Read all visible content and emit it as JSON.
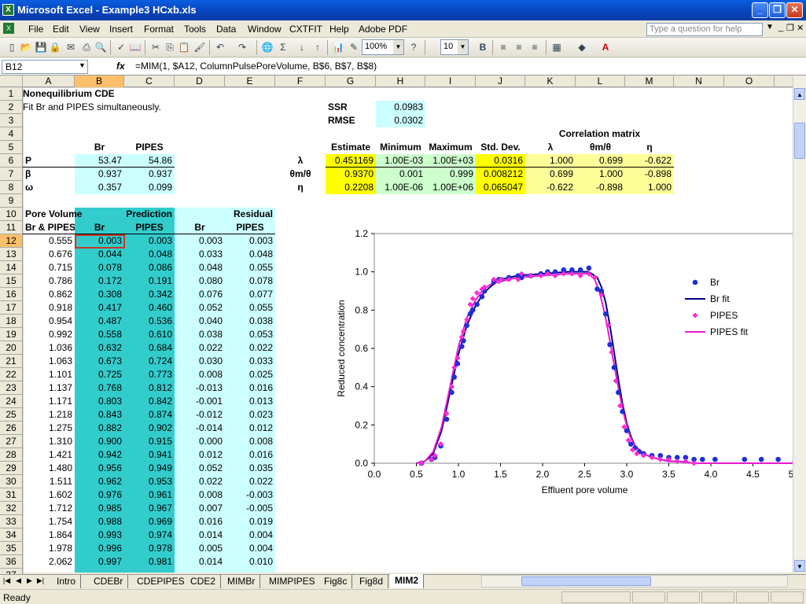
{
  "window": {
    "title": "Microsoft Excel - Example3 HCxb.xls"
  },
  "menu": [
    "File",
    "Edit",
    "View",
    "Insert",
    "Format",
    "Tools",
    "Data",
    "Window",
    "CXTFIT",
    "Help",
    "Adobe PDF"
  ],
  "help_placeholder": "Type a question for help",
  "toolbar": {
    "zoom": "100%",
    "font_size": "10"
  },
  "namebox": "B12",
  "formula": "=MIM(1, $A12, ColumnPulsePoreVolume, B$6, B$7, B$8)",
  "columns": [
    "A",
    "B",
    "C",
    "D",
    "E",
    "F",
    "G",
    "H",
    "I",
    "J",
    "K",
    "L",
    "M",
    "N",
    "O"
  ],
  "selected_column": "B",
  "rows": [
    "1",
    "2",
    "3",
    "4",
    "5",
    "6",
    "7",
    "8",
    "9",
    "10",
    "11",
    "12",
    "13",
    "14",
    "15",
    "16",
    "17",
    "18",
    "19",
    "20",
    "21",
    "22",
    "23",
    "24",
    "25",
    "26",
    "27",
    "28",
    "29",
    "30",
    "31",
    "32",
    "33",
    "34",
    "35",
    "36",
    "37"
  ],
  "selected_row": "12",
  "sheet": {
    "title": "Nonequilibrium CDE",
    "subtitle": "Fit Br and PIPES simultaneously.",
    "param_headers": [
      "Br",
      "PIPES"
    ],
    "params": [
      {
        "label": "P",
        "br": "53.47",
        "pipes": "54.86"
      },
      {
        "label": "β",
        "br": "0.937",
        "pipes": "0.937"
      },
      {
        "label": "ω",
        "br": "0.357",
        "pipes": "0.099"
      }
    ],
    "ssr_label": "SSR",
    "ssr": "0.0983",
    "rmse_label": "RMSE",
    "rmse": "0.0302",
    "corr_title": "Correlation matrix",
    "stats_headers": [
      "Estimate",
      "Minimum",
      "Maximum",
      "Std. Dev.",
      "λ",
      "θm/θ",
      "η"
    ],
    "stats_rows": [
      {
        "label": "λ",
        "cells": [
          "0.451169",
          "1.00E-03",
          "1.00E+03",
          "0.0316",
          "1.000",
          "0.699",
          "-0.622"
        ]
      },
      {
        "label": "θm/θ",
        "cells": [
          "0.9370",
          "0.001",
          "0.999",
          "0.008212",
          "0.699",
          "1.000",
          "-0.898"
        ]
      },
      {
        "label": "η",
        "cells": [
          "0.2208",
          "1.00E-06",
          "1.00E+06",
          "0.065047",
          "-0.622",
          "-0.898",
          "1.000"
        ]
      }
    ],
    "table_head1": [
      "Pore Volume",
      "Prediction",
      "Residual"
    ],
    "table_head2": [
      "Br & PIPES",
      "Br",
      "PIPES",
      "Br",
      "PIPES"
    ],
    "table": [
      [
        "0.555",
        "0.003",
        "0.003",
        "0.003",
        "0.003"
      ],
      [
        "0.676",
        "0.044",
        "0.048",
        "0.033",
        "0.048"
      ],
      [
        "0.715",
        "0.078",
        "0.086",
        "0.048",
        "0.055"
      ],
      [
        "0.786",
        "0.172",
        "0.191",
        "0.080",
        "0.078"
      ],
      [
        "0.862",
        "0.308",
        "0.342",
        "0.076",
        "0.077"
      ],
      [
        "0.918",
        "0.417",
        "0.460",
        "0.052",
        "0.055"
      ],
      [
        "0.954",
        "0.487",
        "0.536",
        "0.040",
        "0.038"
      ],
      [
        "0.992",
        "0.558",
        "0.610",
        "0.038",
        "0.053"
      ],
      [
        "1.036",
        "0.632",
        "0.684",
        "0.022",
        "0.022"
      ],
      [
        "1.063",
        "0.673",
        "0.724",
        "0.030",
        "0.033"
      ],
      [
        "1.101",
        "0.725",
        "0.773",
        "0.008",
        "0.025"
      ],
      [
        "1.137",
        "0.768",
        "0.812",
        "-0.013",
        "0.016"
      ],
      [
        "1.171",
        "0.803",
        "0.842",
        "-0.001",
        "0.013"
      ],
      [
        "1.218",
        "0.843",
        "0.874",
        "-0.012",
        "0.023"
      ],
      [
        "1.275",
        "0.882",
        "0.902",
        "-0.014",
        "0.012"
      ],
      [
        "1.310",
        "0.900",
        "0.915",
        "0.000",
        "0.008"
      ],
      [
        "1.421",
        "0.942",
        "0.941",
        "0.012",
        "0.016"
      ],
      [
        "1.480",
        "0.956",
        "0.949",
        "0.052",
        "0.035"
      ],
      [
        "1.511",
        "0.962",
        "0.953",
        "0.022",
        "0.022"
      ],
      [
        "1.602",
        "0.976",
        "0.961",
        "0.008",
        "-0.003"
      ],
      [
        "1.712",
        "0.985",
        "0.967",
        "0.007",
        "-0.005"
      ],
      [
        "1.754",
        "0.988",
        "0.969",
        "0.016",
        "0.019"
      ],
      [
        "1.864",
        "0.993",
        "0.974",
        "0.014",
        "0.004"
      ],
      [
        "1.978",
        "0.996",
        "0.978",
        "0.005",
        "0.004"
      ],
      [
        "2.062",
        "0.997",
        "0.981",
        "0.014",
        "0.010"
      ]
    ]
  },
  "chart_data": {
    "type": "scatter",
    "xlabel": "Effluent pore volume",
    "ylabel": "Reduced concentration",
    "xlim": [
      0,
      5
    ],
    "ylim": [
      0,
      1.2
    ],
    "xticks": [
      "0.0",
      "0.5",
      "1.0",
      "1.5",
      "2.0",
      "2.5",
      "3.0",
      "3.5",
      "4.0",
      "4.5",
      "5.0"
    ],
    "yticks": [
      "0.0",
      "0.2",
      "0.4",
      "0.6",
      "0.8",
      "1.0",
      "1.2"
    ],
    "legend_position": "right",
    "colors": {
      "br": "#1f2fd8",
      "br_fit": "#00008b",
      "pipes": "#ff2bd6",
      "pipes_fit": "#e81ad0"
    },
    "series": [
      {
        "name": "Br",
        "kind": "points",
        "x": [
          0.56,
          0.68,
          0.72,
          0.79,
          0.86,
          0.92,
          0.95,
          0.99,
          1.04,
          1.06,
          1.1,
          1.14,
          1.17,
          1.22,
          1.28,
          1.31,
          1.42,
          1.48,
          1.51,
          1.6,
          1.71,
          1.75,
          1.86,
          1.98,
          2.06,
          2.15,
          2.25,
          2.35,
          2.45,
          2.55,
          2.65,
          2.7,
          2.75,
          2.8,
          2.85,
          2.9,
          2.95,
          3.0,
          3.05,
          3.1,
          3.15,
          3.2,
          3.3,
          3.4,
          3.5,
          3.6,
          3.7,
          3.8,
          3.9,
          4.05,
          4.4,
          4.6,
          4.8,
          5.0
        ],
        "y": [
          0.0,
          0.02,
          0.03,
          0.09,
          0.23,
          0.37,
          0.45,
          0.52,
          0.61,
          0.64,
          0.72,
          0.78,
          0.8,
          0.83,
          0.87,
          0.9,
          0.95,
          0.96,
          0.96,
          0.97,
          0.98,
          0.97,
          0.98,
          0.99,
          1.0,
          1.0,
          1.01,
          1.01,
          1.01,
          1.02,
          0.91,
          0.9,
          0.78,
          0.62,
          0.5,
          0.37,
          0.27,
          0.17,
          0.1,
          0.08,
          0.06,
          0.05,
          0.04,
          0.04,
          0.03,
          0.03,
          0.03,
          0.02,
          0.02,
          0.02,
          0.02,
          0.02,
          0.02,
          0.01
        ]
      },
      {
        "name": "Br fit",
        "kind": "line",
        "x": [
          0.5,
          0.6,
          0.7,
          0.8,
          0.9,
          1.0,
          1.1,
          1.2,
          1.3,
          1.4,
          1.5,
          1.7,
          2.0,
          2.3,
          2.55,
          2.65,
          2.7,
          2.75,
          2.8,
          2.85,
          2.9,
          2.95,
          3.0,
          3.05,
          3.1,
          3.2,
          3.3,
          3.4,
          3.5,
          3.6,
          3.8,
          4.0,
          4.5,
          5.0
        ],
        "y": [
          0.0,
          0.01,
          0.05,
          0.17,
          0.37,
          0.57,
          0.72,
          0.82,
          0.89,
          0.93,
          0.96,
          0.98,
          0.99,
          1.0,
          1.0,
          0.97,
          0.92,
          0.84,
          0.72,
          0.58,
          0.44,
          0.31,
          0.21,
          0.14,
          0.09,
          0.05,
          0.03,
          0.02,
          0.01,
          0.01,
          0.0,
          0.0,
          0.0,
          0.0
        ]
      },
      {
        "name": "PIPES",
        "kind": "points",
        "x": [
          0.56,
          0.68,
          0.72,
          0.79,
          0.86,
          0.92,
          0.95,
          0.99,
          1.04,
          1.06,
          1.1,
          1.14,
          1.17,
          1.22,
          1.28,
          1.31,
          1.42,
          1.48,
          1.51,
          1.6,
          1.71,
          1.75,
          1.86,
          1.98,
          2.06,
          2.15,
          2.25,
          2.35,
          2.45,
          2.55,
          2.62,
          2.7,
          2.78,
          2.82,
          2.87,
          2.92,
          2.97,
          3.02,
          3.07,
          3.12,
          3.2,
          3.3,
          3.4,
          3.5,
          3.6,
          3.7,
          3.8
        ],
        "y": [
          0.0,
          0.02,
          0.04,
          0.1,
          0.26,
          0.4,
          0.5,
          0.55,
          0.66,
          0.69,
          0.75,
          0.83,
          0.86,
          0.89,
          0.91,
          0.92,
          0.96,
          0.95,
          0.96,
          0.96,
          0.96,
          0.99,
          0.98,
          0.98,
          0.99,
          0.98,
          0.99,
          0.99,
          0.98,
          0.99,
          0.97,
          0.88,
          0.72,
          0.58,
          0.43,
          0.3,
          0.19,
          0.12,
          0.07,
          0.05,
          0.04,
          0.03,
          0.02,
          0.02,
          0.01,
          0.01,
          0.0
        ]
      },
      {
        "name": "PIPES fit",
        "kind": "line",
        "x": [
          0.5,
          0.6,
          0.7,
          0.8,
          0.9,
          1.0,
          1.1,
          1.2,
          1.3,
          1.4,
          1.5,
          1.7,
          2.0,
          2.3,
          2.55,
          2.62,
          2.68,
          2.74,
          2.8,
          2.86,
          2.92,
          2.98,
          3.04,
          3.1,
          3.2,
          3.3,
          3.4,
          3.5,
          3.6,
          3.8,
          4.0,
          4.5,
          5.0
        ],
        "y": [
          0.0,
          0.01,
          0.06,
          0.19,
          0.4,
          0.61,
          0.76,
          0.85,
          0.91,
          0.94,
          0.95,
          0.97,
          0.98,
          0.99,
          0.99,
          0.96,
          0.89,
          0.78,
          0.64,
          0.49,
          0.35,
          0.23,
          0.14,
          0.09,
          0.05,
          0.03,
          0.02,
          0.01,
          0.01,
          0.0,
          0.0,
          0.0,
          0.0
        ]
      }
    ]
  },
  "sheet_tabs": [
    "Intro",
    "CDEBr",
    "CDEPIPES",
    "CDE2",
    "MIMBr",
    "MIMPIPES",
    "Fig8c",
    "Fig8d",
    "MIM2"
  ],
  "active_tab": "MIM2",
  "status": "Ready"
}
